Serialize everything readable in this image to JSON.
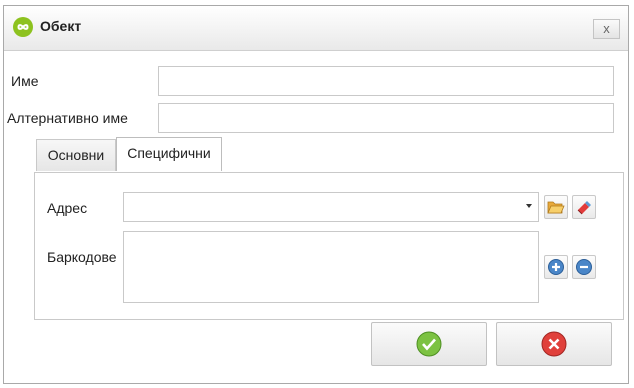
{
  "window": {
    "title": "Обект",
    "close_label": "x",
    "logo_icon": "infinity-logo-icon",
    "accent_color": "#8dc21f"
  },
  "form": {
    "name_label": "Име",
    "name_value": "",
    "alt_name_label": "Алтернативно име",
    "alt_name_value": ""
  },
  "tabs": [
    {
      "label": "Основни",
      "active": false
    },
    {
      "label": "Специфични",
      "active": true
    }
  ],
  "specific": {
    "address_label": "Адрес",
    "address_value": "",
    "address_buttons": [
      "folder-open-icon",
      "eraser-icon"
    ],
    "barcodes_label": "Баркодове",
    "barcodes_value": "",
    "barcodes_buttons": [
      "add-circle-icon",
      "remove-circle-icon"
    ]
  },
  "footer": {
    "ok_icon": "checkmark-icon",
    "cancel_icon": "cancel-x-icon"
  }
}
